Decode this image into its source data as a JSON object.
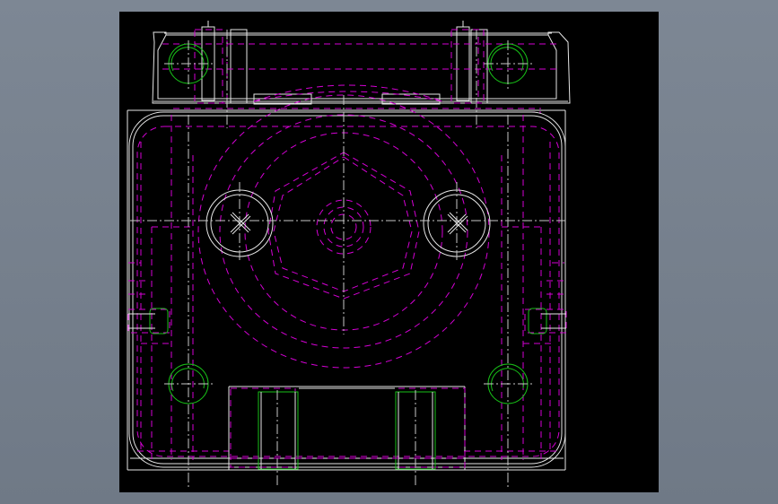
{
  "viewer": {
    "background_color": "#7b8591",
    "canvas_color": "#000000"
  },
  "drawing": {
    "colors": {
      "visible_edges": "#e6e6e6",
      "hidden_edges": "#d400d4",
      "threads": "#18c018",
      "centerlines": "#c8c8c8"
    }
  }
}
